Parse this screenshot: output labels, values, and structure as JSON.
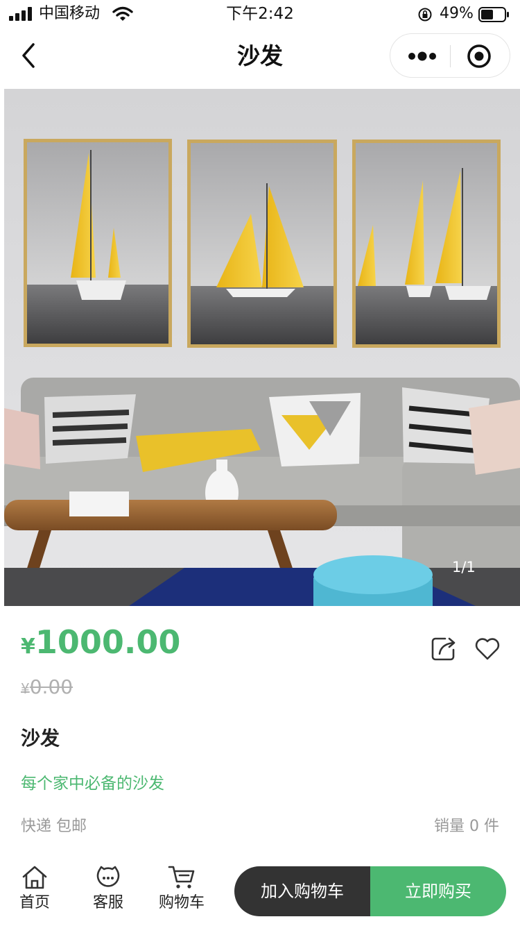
{
  "status_bar": {
    "carrier": "中国移动",
    "time": "下午2:42",
    "battery": "49%"
  },
  "nav": {
    "title": "沙发"
  },
  "gallery": {
    "counter": "1/1"
  },
  "product": {
    "currency": "¥",
    "price": "1000.00",
    "original_price": "0.00",
    "name": "沙发",
    "description": "每个家中必备的沙发",
    "shipping": "快递 包邮",
    "sales": "销量 0 件"
  },
  "tabbar": {
    "home": "首页",
    "service": "客服",
    "cart": "购物车"
  },
  "actions": {
    "add_to_cart": "加入购物车",
    "buy_now": "立即购买"
  },
  "colors": {
    "accent": "#4cb871",
    "dark_button": "#333333"
  },
  "icons": [
    "signal-icon",
    "wifi-icon",
    "lock-rotation-icon",
    "battery-icon",
    "back-arrow-icon",
    "more-dots-icon",
    "close-target-icon",
    "share-icon",
    "heart-icon",
    "home-icon",
    "service-icon",
    "cart-icon"
  ]
}
